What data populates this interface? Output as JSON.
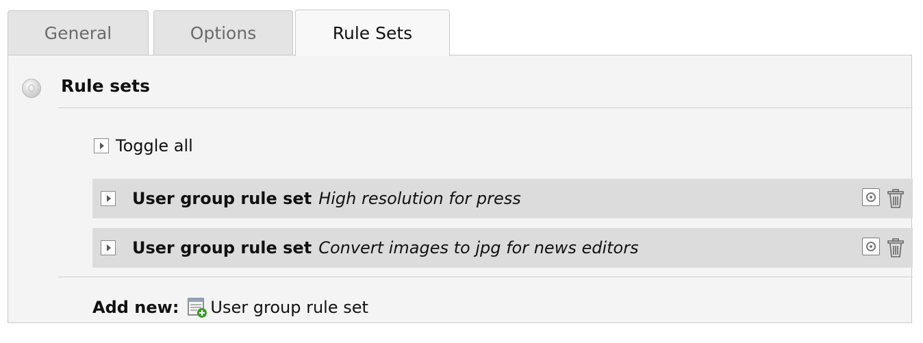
{
  "tabs": [
    {
      "label": "General",
      "active": false
    },
    {
      "label": "Options",
      "active": false
    },
    {
      "label": "Rule Sets",
      "active": true
    }
  ],
  "section": {
    "title": "Rule sets",
    "toggle_all_label": "Toggle all"
  },
  "rulesets": [
    {
      "type": "User group rule set",
      "name": "High resolution for press"
    },
    {
      "type": "User group rule set",
      "name": "Convert images to jpg for news editors"
    }
  ],
  "add_new": {
    "label": "Add new:",
    "link_label": "User group rule set"
  },
  "icons": {
    "help": "help-icon",
    "expand": "triangle-right-icon",
    "move": "move-icon",
    "delete": "trash-icon",
    "new_record": "new-record-icon"
  },
  "colors": {
    "panel_bg": "#f4f4f4",
    "row_bg": "#dcdcdc",
    "tab_bg": "#e4e4e4",
    "active_tab_bg": "#f8f8f8",
    "new_record_plus": "#3a9a2a"
  }
}
